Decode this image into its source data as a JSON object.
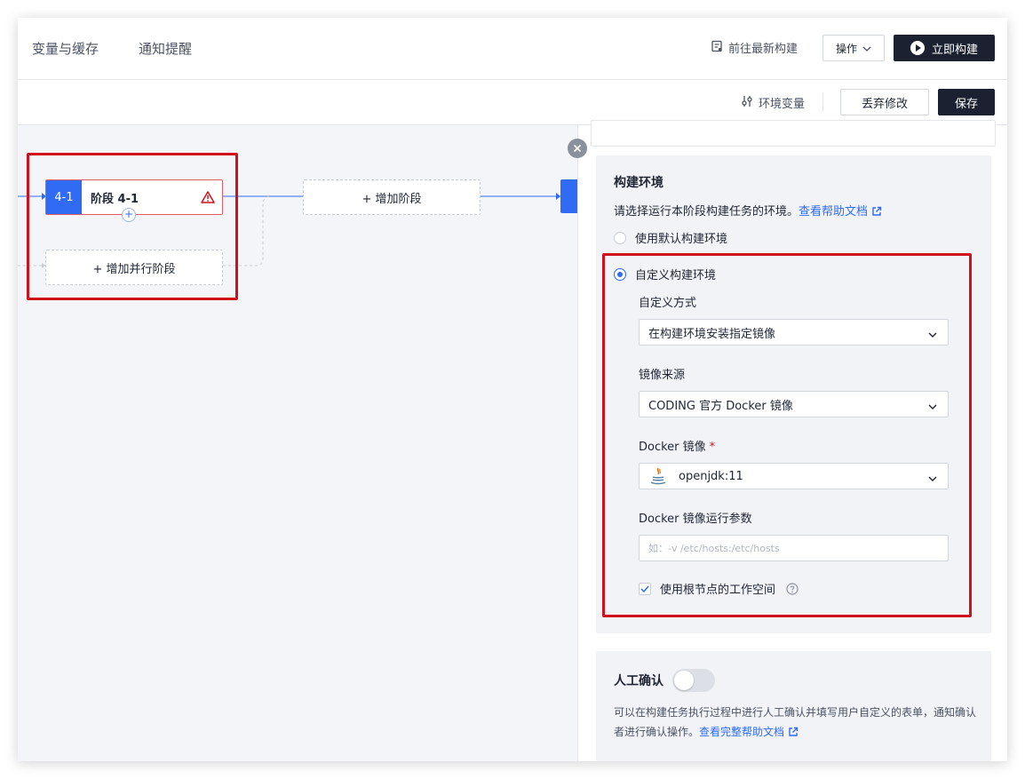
{
  "topbar": {
    "tabs": [
      "变量与缓存",
      "通知提醒"
    ],
    "goto_latest": "前往最新构建",
    "ops": "操作",
    "build_now": "立即构建"
  },
  "toolbar": {
    "env_vars": "环境变量",
    "discard": "丢弃修改",
    "save": "保存"
  },
  "canvas": {
    "stage_id": "4-1",
    "stage_name": "阶段 4-1",
    "add_parallel": "+ 增加并行阶段",
    "add_stage": "+ 增加阶段"
  },
  "build_env": {
    "title": "构建环境",
    "desc": "请选择运行本阶段构建任务的环境。",
    "help_link": "查看帮助文档",
    "option_default": "使用默认构建环境",
    "option_custom": "自定义构建环境",
    "custom_mode_label": "自定义方式",
    "custom_mode_value": "在构建环境安装指定镜像",
    "image_source_label": "镜像来源",
    "image_source_value": "CODING 官方 Docker 镜像",
    "docker_image_label": "Docker 镜像",
    "required_mark": "*",
    "docker_image_value": "openjdk:11",
    "docker_args_label": "Docker 镜像运行参数",
    "docker_args_placeholder": "如：-v /etc/hosts:/etc/hosts",
    "use_root_workspace": "使用根节点的工作空间"
  },
  "manual_confirm": {
    "title": "人工确认",
    "desc": "可以在构建任务执行过程中进行人工确认并填写用户自定义的表单，通知确认者进行确认操作。",
    "help_link": "查看完整帮助文档"
  },
  "colors": {
    "accent": "#2f6bf3",
    "dark_button": "#1b2130",
    "highlight_red": "#d0101b"
  }
}
